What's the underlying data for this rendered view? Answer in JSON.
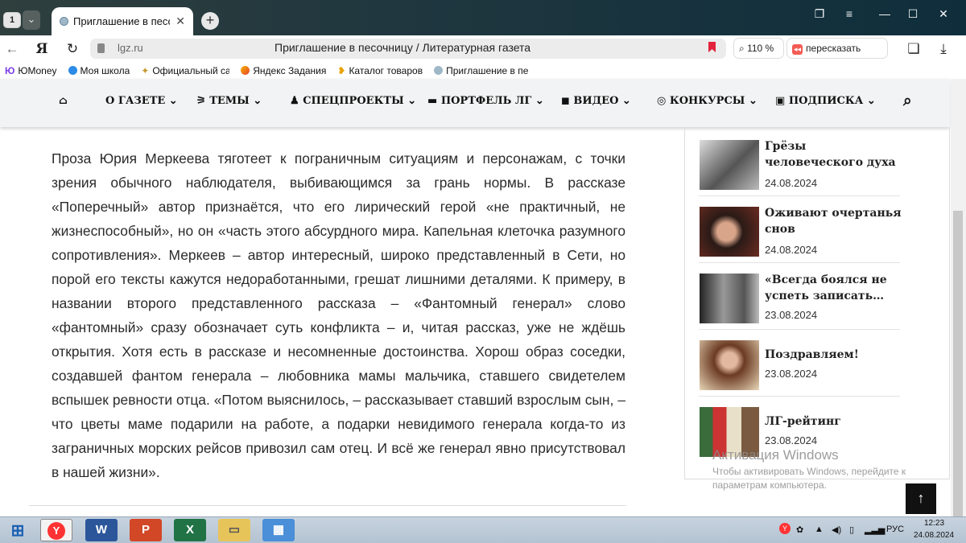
{
  "browser": {
    "tab_count": "1",
    "tab_title": "Приглашение в песочн",
    "url": "lgz.ru",
    "page_title": "Приглашение в песочницу / Литературная газета",
    "zoom": "110 %",
    "retell_label": "пересказать",
    "bookmarks": [
      "ЮMoney",
      "Моя школа",
      "Официальный са",
      "Яндекс Задания",
      "Каталог товаров",
      "Приглашение в пе"
    ]
  },
  "site_nav": {
    "items": [
      "О ГАЗЕТЕ",
      "ТЕМЫ",
      "СПЕЦПРОЕКТЫ",
      "ПОРТФЕЛЬ ЛГ",
      "ВИДЕО",
      "КОНКУРСЫ",
      "ПОДПИСКА"
    ]
  },
  "article": {
    "paragraph": "Проза Юрия Меркеева тяготеет к пограничным ситуациям и персонажам, с точки зрения обычного наблюдателя, выбивающимся за грань нормы. В рассказе «Поперечный» автор признаётся, что его лирический герой «не практичный, не жизнеспособный», но он «часть этого абсурдного мира. Капельная клеточка разумного сопротивления». Меркеев – автор интересный, широко представленный в Сети, но порой его тексты кажутся недоработанными, грешат лишними деталями. К примеру, в названии второго представленного рассказа – «Фантомный генерал» слово «фантомный» сразу обозначает суть конфликта – и, читая рассказ, уже не ждёшь открытия. Хотя есть в рассказе и несомненные достоинства. Хорош образ соседки, создавшей фантом генерала – любовника мамы мальчика, ставшего свидетелем вспышек ревности отца. «Потом выяснилось, – рассказывает ставший взрослым сын, – что цветы маме подарили на работе, а подарки невидимого генерала когда-то из заграничных морских рейсов привозил сам отец. И всё же генерал явно присутствовал в нашей жизни»."
  },
  "sidebar": {
    "items": [
      {
        "title": "Грёзы человеческого духа",
        "date": "24.08.2024"
      },
      {
        "title": "Оживают очертанья снов",
        "date": "24.08.2024"
      },
      {
        "title": "«Всегда боялся не успеть записать…",
        "date": "23.08.2024"
      },
      {
        "title": "Поздравляем!",
        "date": "23.08.2024"
      },
      {
        "title": "ЛГ-рейтинг",
        "date": "23.08.2024"
      }
    ]
  },
  "watermark": {
    "line1": "Активация Windows",
    "line2": "Чтобы активировать Windows, перейдите к параметрам компьютера."
  },
  "taskbar": {
    "lang": "РУС",
    "time": "12:23",
    "date": "24.08.2024"
  },
  "colors": {
    "accent_bookmark": "#e2233c",
    "yandex_red": "#ff3333",
    "nav_bg": "#f2f3f4"
  }
}
